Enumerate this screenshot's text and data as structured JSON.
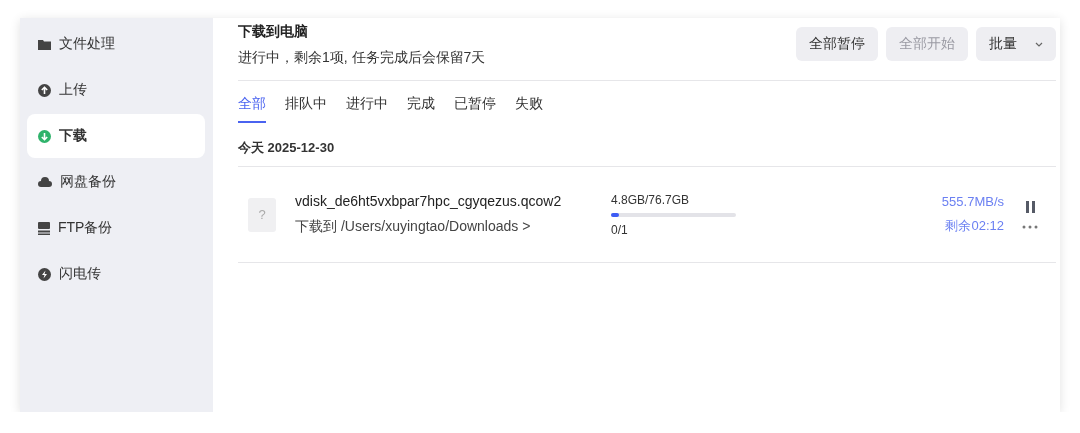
{
  "sidebar": {
    "items": [
      {
        "label": "文件处理",
        "selected": false
      },
      {
        "label": "上传",
        "selected": false
      },
      {
        "label": "下载",
        "selected": true
      },
      {
        "label": "网盘备份",
        "selected": false
      },
      {
        "label": "FTP备份",
        "selected": false
      },
      {
        "label": "闪电传",
        "selected": false
      }
    ]
  },
  "header": {
    "title": "下载到电脑",
    "subtitle": "进行中，剩余1项, 任务完成后会保留7天",
    "buttons": [
      {
        "label": "全部暂停",
        "disabled": false,
        "dropdown": false
      },
      {
        "label": "全部开始",
        "disabled": true,
        "dropdown": false
      },
      {
        "label": "批量",
        "disabled": false,
        "dropdown": true
      }
    ]
  },
  "tabs": [
    {
      "label": "全部",
      "selected": true
    },
    {
      "label": "排队中",
      "selected": false
    },
    {
      "label": "进行中",
      "selected": false
    },
    {
      "label": "完成",
      "selected": false
    },
    {
      "label": "已暂停",
      "selected": false
    },
    {
      "label": "失败",
      "selected": false
    }
  ],
  "groups": [
    {
      "date": "今天 2025-12-30",
      "tasks": [
        {
          "file_icon_glyph": "?",
          "name": "vdisk_de6ht5vxbpar7hpc_cgyqezus.qcow2",
          "destination": "下载到 /Users/xuyingtao/Downloads >",
          "size": "4.8GB/76.7GB",
          "level": 0.06,
          "count": "0/1",
          "speed": "555.7MB/s",
          "remaining": "剩余02:12"
        }
      ]
    }
  ]
}
